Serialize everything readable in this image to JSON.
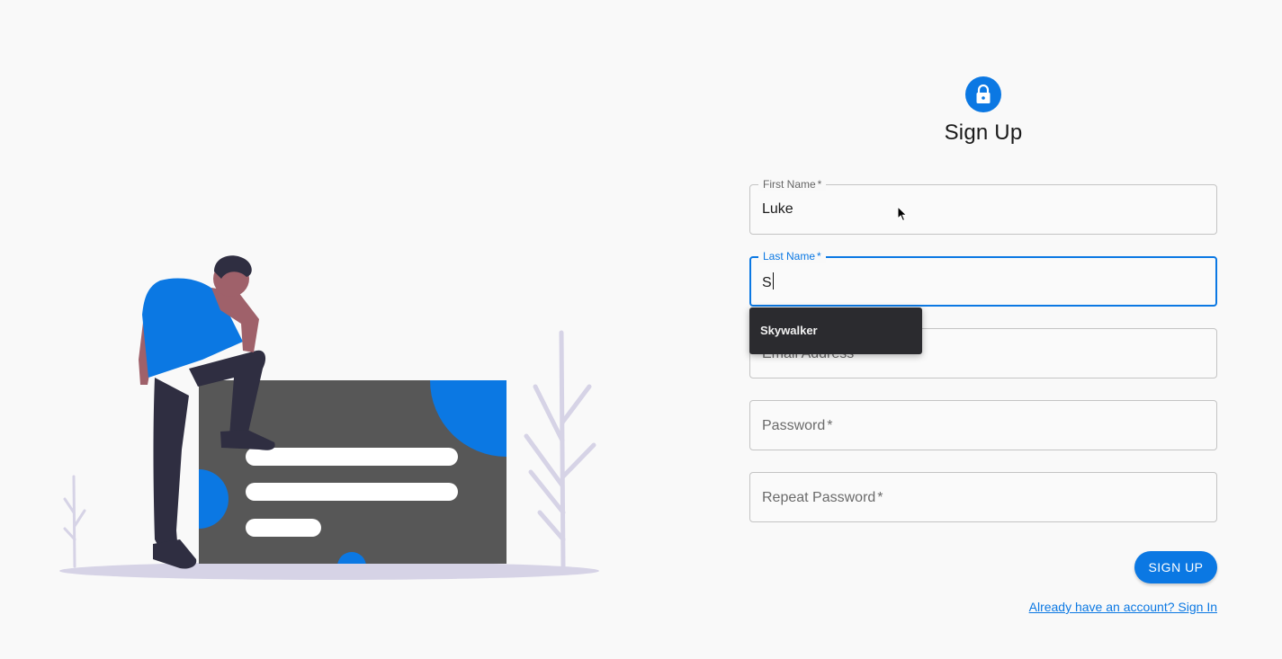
{
  "form": {
    "title": "Sign Up",
    "first_name": {
      "label": "First Name",
      "required_mark": "*",
      "value": "Luke"
    },
    "last_name": {
      "label": "Last Name",
      "required_mark": "*",
      "value": "S"
    },
    "email": {
      "label": "Email Address",
      "required_mark": "*"
    },
    "password": {
      "label": "Password",
      "required_mark": "*"
    },
    "repeat_password": {
      "label": "Repeat Password",
      "required_mark": "*"
    },
    "autocomplete": {
      "options": [
        "Skywalker"
      ]
    },
    "submit_label": "SIGN UP",
    "signin_link": "Already have an account? Sign In"
  },
  "icons": {
    "lock_badge": "lock-icon",
    "illustration": "thinking-person-illustration",
    "cursor": "mouse-cursor-icon"
  },
  "colors": {
    "accent": "#0b78e3",
    "background": "#f9f9f9",
    "autocomplete_bg": "#2b2b2f"
  }
}
